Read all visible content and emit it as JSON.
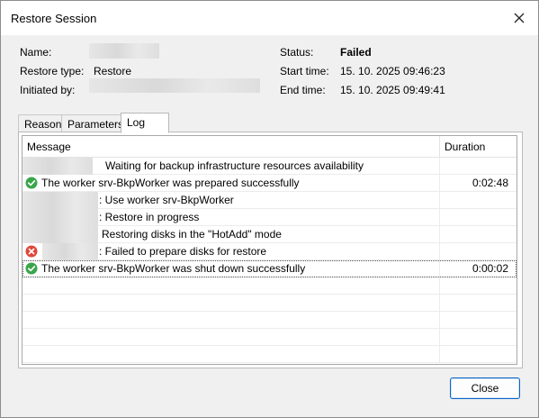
{
  "window": {
    "title": "Restore Session",
    "close_glyph": "×"
  },
  "summary": {
    "name_label": "Name:",
    "restore_type_label": "Restore type:",
    "restore_type_value": "Restore",
    "initiated_by_label": "Initiated by:",
    "status_label": "Status:",
    "status_value": "Failed",
    "start_time_label": "Start time:",
    "start_time_value": "15. 10. 2025 09:46:23",
    "end_time_label": "End time:",
    "end_time_value": "15. 10. 2025 09:49:41"
  },
  "tabs": [
    {
      "label": "Reason"
    },
    {
      "label": "Parameters"
    },
    {
      "label": "Log",
      "active": true
    }
  ],
  "log": {
    "columns": {
      "message": "Message",
      "duration": "Duration"
    },
    "rows": [
      {
        "icon": "none",
        "message": "Waiting for backup infrastructure resources availability",
        "duration": ""
      },
      {
        "icon": "success-icon",
        "message": "The worker srv-BkpWorker was prepared successfully",
        "duration": "0:02:48"
      },
      {
        "icon": "none",
        "message": ": Use worker srv-BkpWorker",
        "duration": ""
      },
      {
        "icon": "none",
        "message": ": Restore in progress",
        "duration": ""
      },
      {
        "icon": "none",
        "message": "Restoring disks in the \"HotAdd\" mode",
        "duration": ""
      },
      {
        "icon": "error-icon",
        "message": ": Failed to prepare disks for restore",
        "duration": ""
      },
      {
        "icon": "success-icon",
        "message": "The worker srv-BkpWorker was shut down successfully",
        "duration": "0:00:02"
      }
    ]
  },
  "buttons": {
    "close_label": "Close"
  },
  "colors": {
    "success": "#3aa54a",
    "error": "#e0463a",
    "accent": "#0a64c8"
  }
}
